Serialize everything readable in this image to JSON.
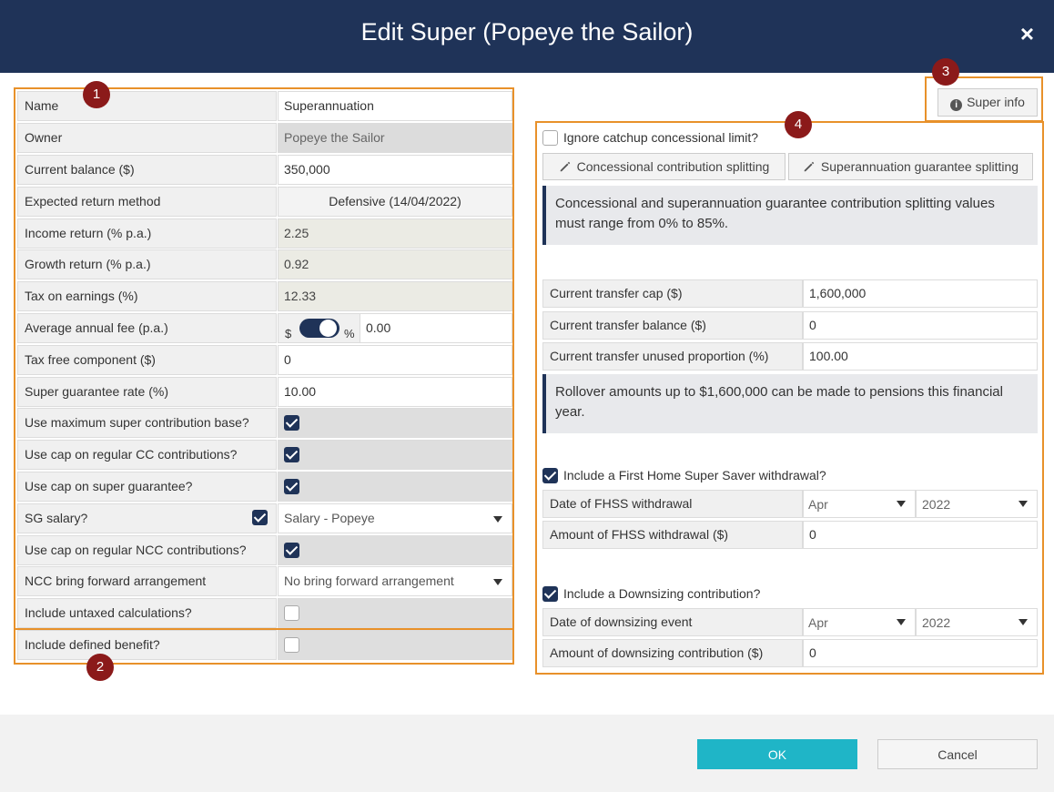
{
  "dialog": {
    "title": "Edit Super (Popeye the Sailor)",
    "close_label": "×",
    "ok_label": "OK",
    "cancel_label": "Cancel",
    "super_info_label": "Super info"
  },
  "markers": [
    "1",
    "2",
    "3",
    "4"
  ],
  "left_form": {
    "name": {
      "label": "Name",
      "value": "Superannuation"
    },
    "owner": {
      "label": "Owner",
      "value": "Popeye the Sailor"
    },
    "current_balance": {
      "label": "Current balance ($)",
      "value": "350,000"
    },
    "expected_return_method": {
      "label": "Expected return method",
      "value": "Defensive (14/04/2022)"
    },
    "income_return": {
      "label": "Income return (% p.a.)",
      "value": "2.25"
    },
    "growth_return": {
      "label": "Growth return (% p.a.)",
      "value": "0.92"
    },
    "tax_on_earnings": {
      "label": "Tax on earnings (%)",
      "value": "12.33"
    },
    "average_annual_fee": {
      "label": "Average annual fee (p.a.)",
      "toggle_left": "$",
      "toggle_right": "%",
      "toggle_on": true,
      "value": "0.00"
    },
    "tax_free_component": {
      "label": "Tax free component ($)",
      "value": "0"
    },
    "super_guarantee_rate": {
      "label": "Super guarantee rate (%)",
      "value": "10.00"
    },
    "use_max_contribution_base": {
      "label": "Use maximum super contribution base?",
      "checked": true
    },
    "use_cap_regular_cc": {
      "label": "Use cap on regular CC contributions?",
      "checked": true
    },
    "use_cap_super_guarantee": {
      "label": "Use cap on super guarantee?",
      "checked": true
    },
    "sg_salary": {
      "label": "SG salary?",
      "checked": true,
      "value": "Salary - Popeye"
    },
    "use_cap_regular_ncc": {
      "label": "Use cap on regular NCC contributions?",
      "checked": true
    },
    "ncc_bring_forward": {
      "label": "NCC bring forward arrangement",
      "value": "No bring forward arrangement"
    },
    "include_untaxed": {
      "label": "Include untaxed calculations?",
      "checked": false
    },
    "include_defined_benefit": {
      "label": "Include defined benefit?",
      "checked": false
    }
  },
  "right_panel": {
    "ignore_catchup": {
      "label": "Ignore catchup concessional limit?",
      "checked": false
    },
    "concessional_splitting_label": "Concessional contribution splitting",
    "sg_splitting_label": "Superannuation guarantee splitting",
    "splitting_info": "Concessional and superannuation guarantee contribution splitting values must range from 0% to 85%.",
    "transfer_cap": {
      "label": "Current transfer cap ($)",
      "value": "1,600,000"
    },
    "transfer_balance": {
      "label": "Current transfer balance ($)",
      "value": "0"
    },
    "transfer_unused": {
      "label": "Current transfer unused proportion (%)",
      "value": "100.00"
    },
    "rollover_info": "Rollover amounts up to $1,600,000 can be made to pensions this financial year.",
    "fhss": {
      "label": "Include a First Home Super Saver withdrawal?",
      "checked": true,
      "date_label": "Date of FHSS withdrawal",
      "month": "Apr",
      "year": "2022",
      "amount_label": "Amount of FHSS withdrawal ($)",
      "amount": "0"
    },
    "downsizing": {
      "label": "Include a Downsizing contribution?",
      "checked": true,
      "date_label": "Date of downsizing event",
      "month": "Apr",
      "year": "2022",
      "amount_label": "Amount of downsizing contribution ($)",
      "amount": "0"
    }
  },
  "colors": {
    "header": "#1f3358",
    "accent_ok": "#1fb5c7",
    "highlight_border": "#e8912a",
    "marker": "#8b1a1a",
    "checkbox": "#1f3358"
  },
  "icons": [
    "close-icon",
    "info-icon",
    "pencil-icon",
    "chevron-down-icon",
    "checkbox-icon",
    "toggle-switch"
  ]
}
